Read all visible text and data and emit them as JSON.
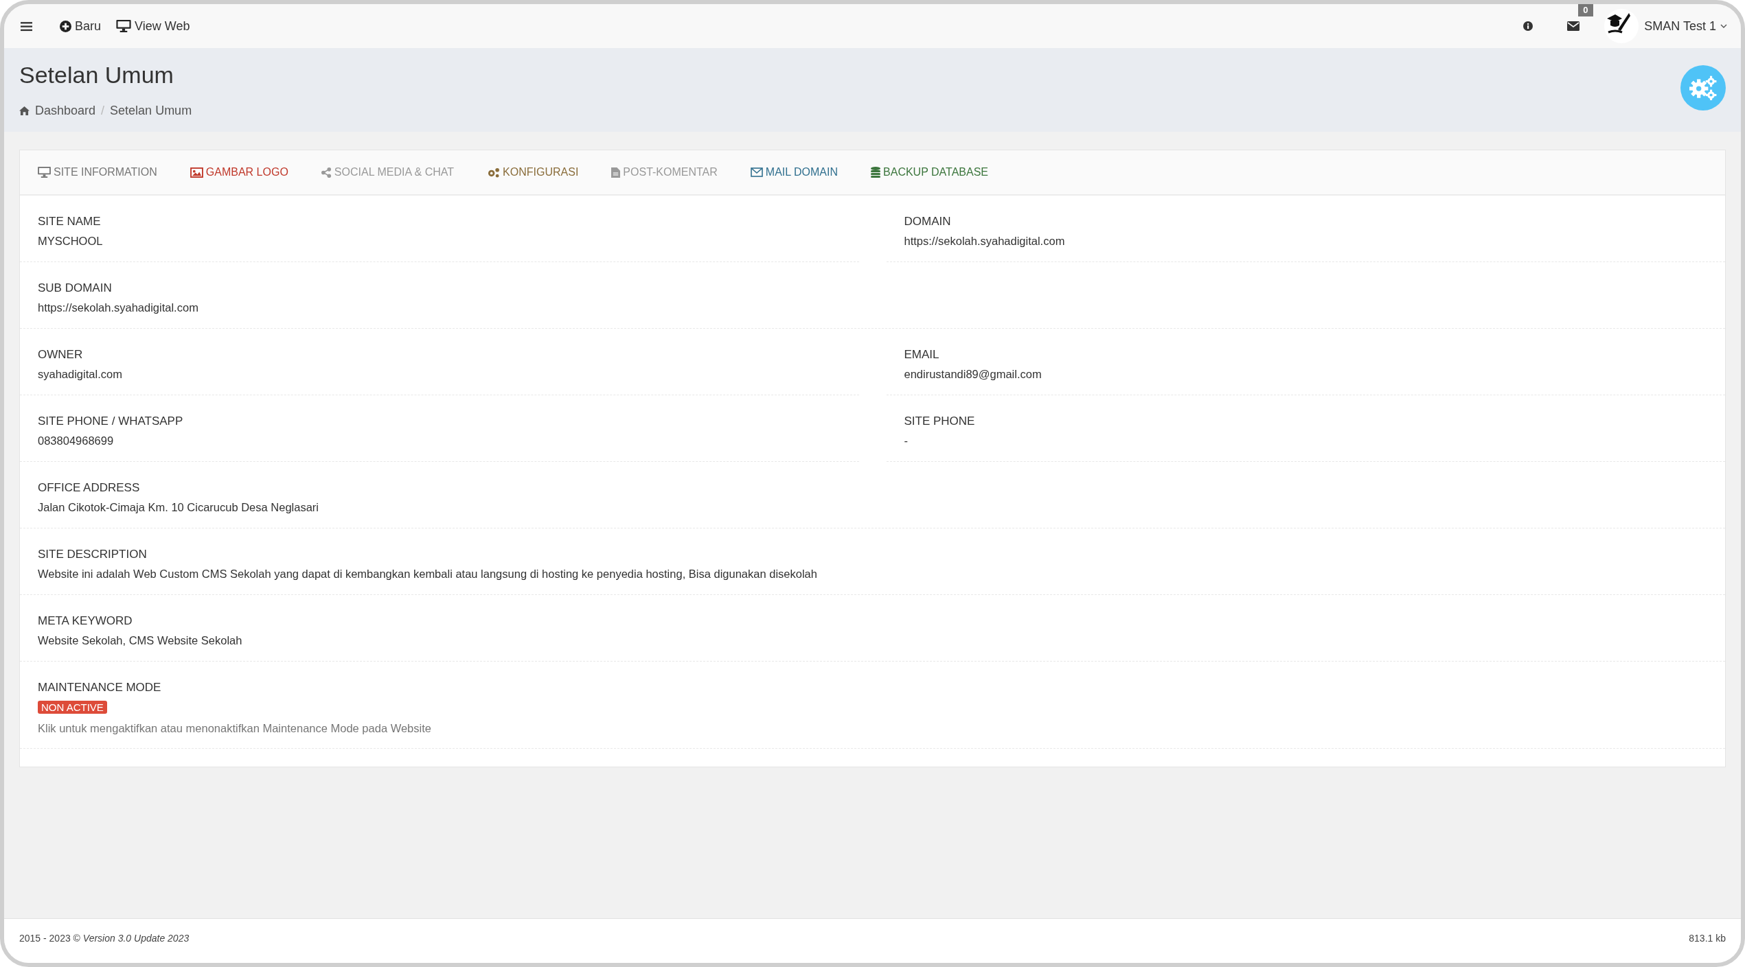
{
  "topbar": {
    "links": [
      {
        "kind": "new",
        "label": "Baru"
      },
      {
        "kind": "web",
        "label": "View Web"
      }
    ],
    "mail_count": "0",
    "user": "SMAN Test 1"
  },
  "header": {
    "title": "Setelan Umum",
    "breadcrumb": [
      "Dashboard",
      "Setelan Umum"
    ],
    "separator": "/"
  },
  "tabs": [
    {
      "kind": "monitor",
      "label": "SITE INFORMATION",
      "color": "#777777"
    },
    {
      "kind": "image",
      "label": "GAMBAR LOGO",
      "color": "#c0392b"
    },
    {
      "kind": "share",
      "label": "SOCIAL MEDIA & CHAT",
      "color": "#999999"
    },
    {
      "kind": "gears",
      "label": "KONFIGURASI",
      "color": "#8a6d3b"
    },
    {
      "kind": "file",
      "label": "POST-KOMENTAR",
      "color": "#999999"
    },
    {
      "kind": "mail",
      "label": "MAIL DOMAIN",
      "color": "#31708f"
    },
    {
      "kind": "database",
      "label": "BACKUP DATABASE",
      "color": "#3c763d"
    }
  ],
  "rows": [
    [
      {
        "label": "SITE NAME",
        "value": "MYSCHOOL"
      },
      {
        "label": "DOMAIN",
        "value": "https://sekolah.syahadigital.com"
      }
    ],
    [
      {
        "label": "SUB DOMAIN",
        "value": "https://sekolah.syahadigital.com"
      }
    ],
    [
      {
        "label": "OWNER",
        "value": "syahadigital.com"
      },
      {
        "label": "EMAIL",
        "value": "endirustandi89@gmail.com"
      }
    ],
    [
      {
        "label": "SITE PHONE / WHATSAPP",
        "value": "083804968699"
      },
      {
        "label": "SITE PHONE",
        "value": "-"
      }
    ],
    [
      {
        "label": "OFFICE ADDRESS",
        "value": "Jalan Cikotok-Cimaja Km. 10 Cicarucub Desa Neglasari"
      }
    ],
    [
      {
        "label": "SITE DESCRIPTION",
        "value": "Website ini adalah Web Custom CMS Sekolah yang dapat di kembangkan kembali atau langsung di hosting ke penyedia hosting, Bisa digunakan disekolah"
      }
    ],
    [
      {
        "label": "META KEYWORD",
        "value": "Website Sekolah, CMS Website Sekolah"
      }
    ]
  ],
  "maintenance": {
    "label": "MAINTENANCE MODE",
    "active": false,
    "badge": "NON ACTIVE",
    "hint": "Klik untuk mengaktifkan atau menonaktifkan Maintenance Mode pada Website"
  },
  "footer": {
    "copyright": "2015 - 2023 © *Version 3.0 Update 2023*",
    "size": "813.1 kb"
  }
}
